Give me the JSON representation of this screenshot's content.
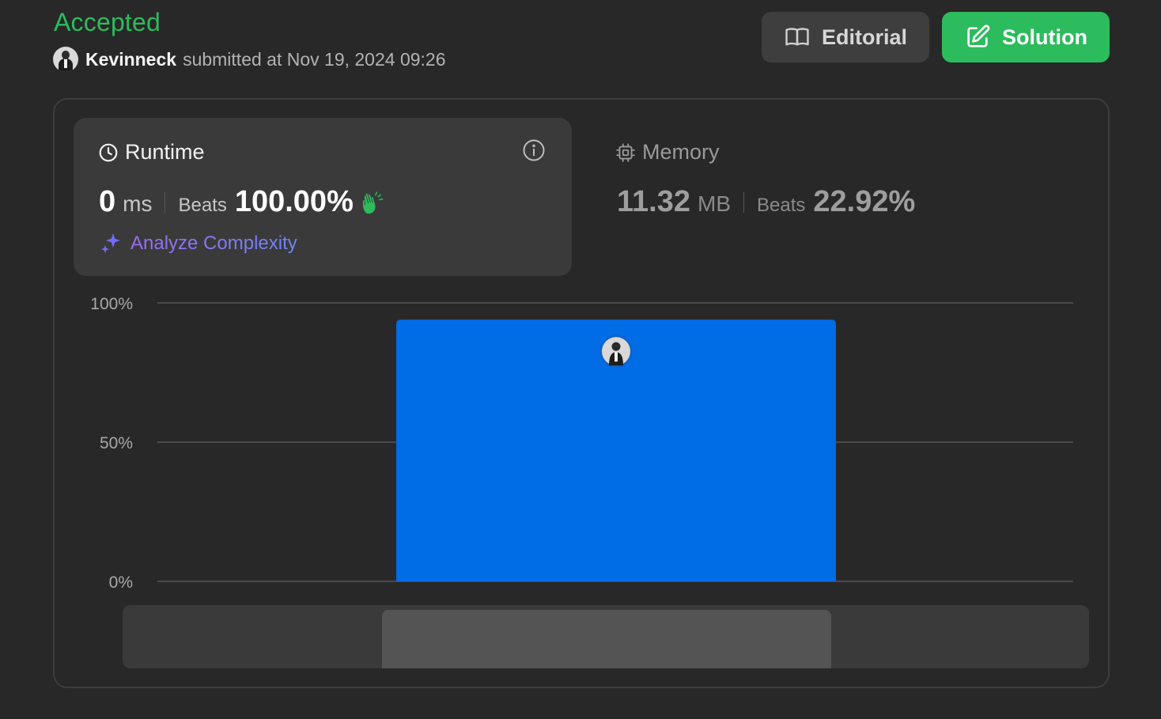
{
  "header": {
    "status": "Accepted",
    "username": "Kevinneck",
    "submitted_text": "submitted at Nov 19, 2024 09:26"
  },
  "buttons": {
    "editorial": "Editorial",
    "solution": "Solution"
  },
  "runtime": {
    "label": "Runtime",
    "value": "0",
    "unit": "ms",
    "beats_label": "Beats",
    "beats_value": "100.00%",
    "analyze_label": "Analyze Complexity"
  },
  "memory": {
    "label": "Memory",
    "value": "11.32",
    "unit": "MB",
    "beats_label": "Beats",
    "beats_value": "22.92%"
  },
  "colors": {
    "accepted": "#2cbb5d",
    "bar": "#006ce6",
    "background": "#282828"
  },
  "icons": {
    "editorial": "book-open-icon",
    "solution": "edit-icon",
    "runtime": "clock-icon",
    "memory": "chip-icon",
    "info": "info-icon",
    "beats": "clap-icon",
    "analyze": "sparkle-icon"
  },
  "chart_data": {
    "type": "bar",
    "categories": [
      ""
    ],
    "values": [
      94
    ],
    "yticks": [
      "100%",
      "50%",
      "0%"
    ],
    "ylim": [
      0,
      100
    ],
    "grid": true,
    "bar_color": "#006ce6",
    "marker": "user-avatar on bar"
  }
}
